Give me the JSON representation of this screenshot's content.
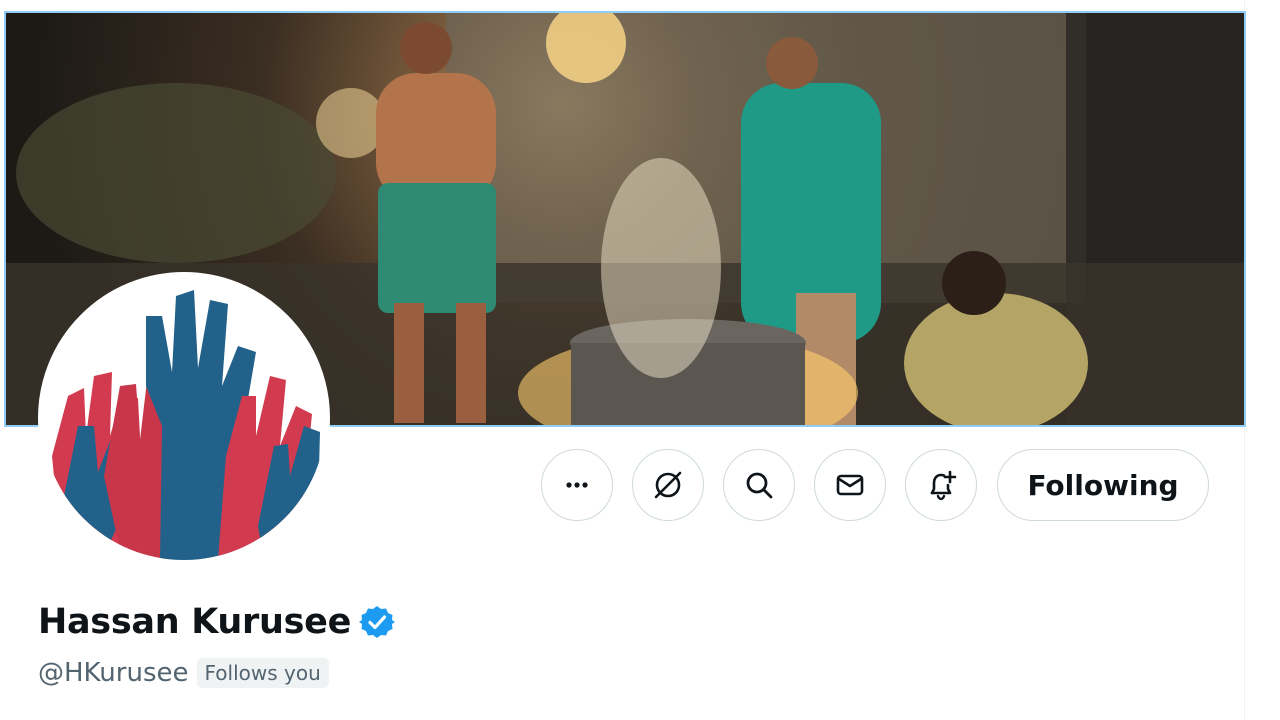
{
  "profile": {
    "display_name": "Hassan Kurusee",
    "verified": true,
    "handle": "@HKurusee",
    "follows_you_label": "Follows you"
  },
  "actions": {
    "more_icon": "more-horizontal-icon",
    "grok_icon": "grok-icon",
    "search_icon": "search-icon",
    "message_icon": "envelope-icon",
    "notify_icon": "bell-plus-icon",
    "following_label": "Following"
  },
  "colors": {
    "verified_blue": "#1d9bf0",
    "banner_border": "#8ecdf8",
    "text_primary": "#0f1419",
    "text_secondary": "#536471",
    "avatar_red": "#d23b4f",
    "avatar_blue": "#22628a"
  }
}
